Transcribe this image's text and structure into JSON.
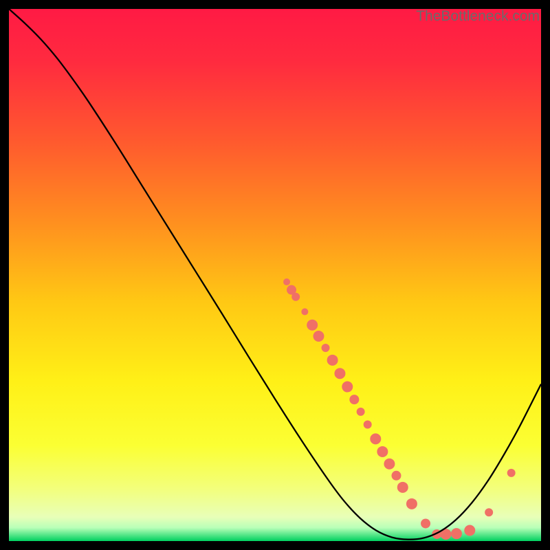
{
  "watermark": "TheBottleneck.com",
  "chart_data": {
    "type": "line",
    "title": "",
    "xlabel": "",
    "ylabel": "",
    "xlim": [
      0,
      100
    ],
    "ylim": [
      0,
      100
    ],
    "gradient_stops": [
      {
        "offset": 0.0,
        "color": "#ff1a44"
      },
      {
        "offset": 0.1,
        "color": "#ff2b3f"
      },
      {
        "offset": 0.25,
        "color": "#ff5a2e"
      },
      {
        "offset": 0.4,
        "color": "#ff8f1f"
      },
      {
        "offset": 0.55,
        "color": "#ffc814"
      },
      {
        "offset": 0.7,
        "color": "#fff017"
      },
      {
        "offset": 0.82,
        "color": "#fbff33"
      },
      {
        "offset": 0.9,
        "color": "#f3ff7a"
      },
      {
        "offset": 0.955,
        "color": "#e8ffb8"
      },
      {
        "offset": 0.975,
        "color": "#b8ffb8"
      },
      {
        "offset": 1.0,
        "color": "#00d060"
      }
    ],
    "curve": [
      {
        "x": 0.0,
        "y": 100.0
      },
      {
        "x": 3.0,
        "y": 97.3
      },
      {
        "x": 6.0,
        "y": 94.3
      },
      {
        "x": 9.0,
        "y": 90.8
      },
      {
        "x": 12.0,
        "y": 86.8
      },
      {
        "x": 15.0,
        "y": 82.5
      },
      {
        "x": 20.0,
        "y": 74.8
      },
      {
        "x": 25.0,
        "y": 66.8
      },
      {
        "x": 30.0,
        "y": 58.8
      },
      {
        "x": 35.0,
        "y": 50.8
      },
      {
        "x": 40.0,
        "y": 42.8
      },
      {
        "x": 45.0,
        "y": 34.7
      },
      {
        "x": 50.0,
        "y": 26.7
      },
      {
        "x": 55.0,
        "y": 18.9
      },
      {
        "x": 60.0,
        "y": 11.5
      },
      {
        "x": 63.0,
        "y": 7.5
      },
      {
        "x": 66.0,
        "y": 4.3
      },
      {
        "x": 69.0,
        "y": 2.0
      },
      {
        "x": 72.0,
        "y": 0.7
      },
      {
        "x": 75.0,
        "y": 0.3
      },
      {
        "x": 78.0,
        "y": 0.6
      },
      {
        "x": 81.0,
        "y": 1.8
      },
      {
        "x": 84.0,
        "y": 4.0
      },
      {
        "x": 87.0,
        "y": 7.2
      },
      {
        "x": 90.0,
        "y": 11.3
      },
      {
        "x": 93.0,
        "y": 16.2
      },
      {
        "x": 96.0,
        "y": 21.6
      },
      {
        "x": 100.0,
        "y": 29.5
      }
    ],
    "dots": [
      {
        "x": 52.2,
        "y": 48.7,
        "r": 5
      },
      {
        "x": 53.1,
        "y": 47.2,
        "r": 7
      },
      {
        "x": 53.9,
        "y": 45.9,
        "r": 6
      },
      {
        "x": 55.6,
        "y": 43.1,
        "r": 5
      },
      {
        "x": 57.0,
        "y": 40.6,
        "r": 8
      },
      {
        "x": 58.2,
        "y": 38.5,
        "r": 8
      },
      {
        "x": 59.5,
        "y": 36.3,
        "r": 6
      },
      {
        "x": 60.8,
        "y": 34.0,
        "r": 8
      },
      {
        "x": 62.2,
        "y": 31.5,
        "r": 8
      },
      {
        "x": 63.6,
        "y": 29.0,
        "r": 8
      },
      {
        "x": 64.9,
        "y": 26.6,
        "r": 7
      },
      {
        "x": 66.1,
        "y": 24.3,
        "r": 6
      },
      {
        "x": 67.4,
        "y": 21.9,
        "r": 6
      },
      {
        "x": 68.9,
        "y": 19.2,
        "r": 8
      },
      {
        "x": 70.2,
        "y": 16.8,
        "r": 8
      },
      {
        "x": 71.5,
        "y": 14.5,
        "r": 8
      },
      {
        "x": 72.8,
        "y": 12.3,
        "r": 7
      },
      {
        "x": 74.0,
        "y": 10.1,
        "r": 8
      },
      {
        "x": 75.7,
        "y": 7.0,
        "r": 8
      },
      {
        "x": 78.3,
        "y": 3.3,
        "r": 7
      },
      {
        "x": 80.4,
        "y": 1.3,
        "r": 7
      },
      {
        "x": 82.1,
        "y": 1.3,
        "r": 8
      },
      {
        "x": 84.1,
        "y": 1.4,
        "r": 8
      },
      {
        "x": 86.6,
        "y": 2.0,
        "r": 8
      },
      {
        "x": 90.2,
        "y": 5.4,
        "r": 6
      },
      {
        "x": 94.4,
        "y": 12.8,
        "r": 6
      }
    ],
    "dot_color": "#f07066",
    "curve_color": "#000000",
    "curve_width": 2.3
  }
}
